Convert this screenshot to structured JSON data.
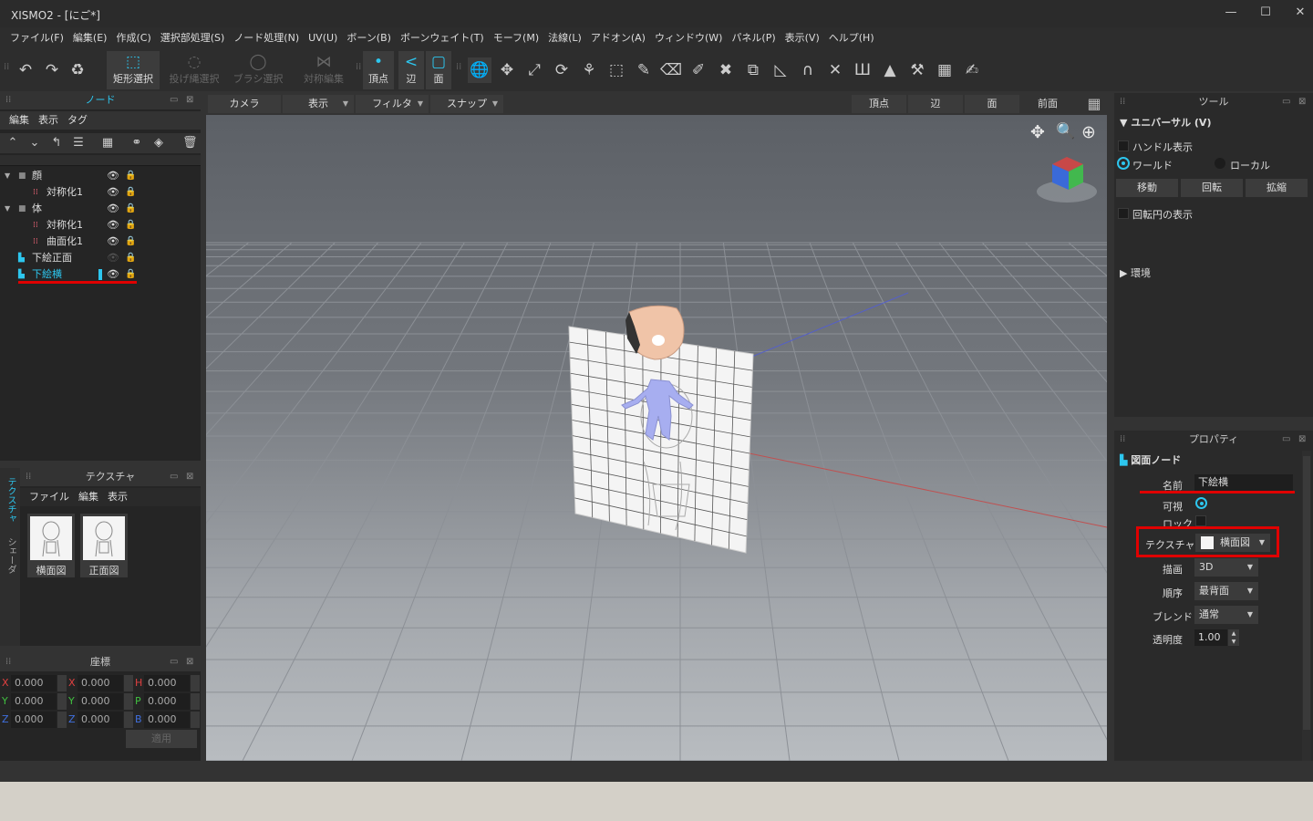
{
  "window": {
    "title": "XISMO2 - [にご*]",
    "min": "—",
    "max": "☐",
    "close": "✕"
  },
  "menubar": [
    "ファイル(F)",
    "編集(E)",
    "作成(C)",
    "選択部処理(S)",
    "ノード処理(N)",
    "UV(U)",
    "ボーン(B)",
    "ボーンウェイト(T)",
    "モーフ(M)",
    "法線(L)",
    "アドオン(A)",
    "ウィンドウ(W)",
    "パネル(P)",
    "表示(V)",
    "ヘルプ(H)"
  ],
  "toolbar": {
    "undo": "↶",
    "redo": "↷",
    "recycle": "♻",
    "rect_select": {
      "icon": "⬚",
      "label": "矩形選択"
    },
    "lasso_select": {
      "icon": "◌",
      "label": "投げ縄選択"
    },
    "brush_select": {
      "icon": "◯",
      "label": "ブラシ選択"
    },
    "symmetry_edit": {
      "icon": "⋈",
      "label": "対称編集"
    },
    "vertex": {
      "icon": "•",
      "label": "頂点"
    },
    "edge": {
      "icon": "<",
      "label": "辺"
    },
    "face": {
      "icon": "▢",
      "label": "面"
    },
    "tools": [
      "🌐",
      "✥",
      "⤢",
      "⟳",
      "⚘",
      "⬚",
      "✎",
      "⌫",
      "✐",
      "✖",
      "⧉",
      "◺",
      "∩",
      "✕",
      "Ш",
      "▲",
      "⚒",
      "▦",
      "✍"
    ]
  },
  "node_panel": {
    "title": "ノード",
    "menu": [
      "編集",
      "表示",
      "タグ"
    ],
    "icons": [
      "⌃",
      "⌄",
      "↰",
      "☰",
      "▦",
      "⚭",
      "◈",
      "🗑"
    ],
    "nodes": [
      {
        "label": "顔",
        "indent": 0,
        "expand": "▼",
        "icon": "■",
        "eye": "👁",
        "lock": "🔒",
        "selected": false
      },
      {
        "label": "対称化1",
        "indent": 1,
        "expand": "",
        "icon": "⁞⁞",
        "eye": "👁",
        "lock": "🔒",
        "selected": false
      },
      {
        "label": "体",
        "indent": 0,
        "expand": "▼",
        "icon": "■",
        "eye": "👁",
        "lock": "🔒",
        "selected": false
      },
      {
        "label": "対称化1",
        "indent": 1,
        "expand": "",
        "icon": "⁞⁞",
        "eye": "👁",
        "lock": "🔒",
        "selected": false
      },
      {
        "label": "曲面化1",
        "indent": 1,
        "expand": "",
        "icon": "⁞⁞",
        "eye": "👁",
        "lock": "🔒",
        "selected": false
      },
      {
        "label": "下絵正面",
        "indent": 0,
        "expand": "",
        "icon": "▙",
        "eye": "👁",
        "lock": "🔒",
        "selected": false
      },
      {
        "label": "下絵横",
        "indent": 0,
        "expand": "",
        "icon": "▙",
        "eye": "👁",
        "lock": "🔒",
        "selected": true
      }
    ]
  },
  "texture_panel": {
    "title": "テクスチャ",
    "menu": [
      "ファイル",
      "編集",
      "表示"
    ],
    "side_tabs": [
      "テクスチャ",
      "シェーダ"
    ],
    "items": [
      {
        "label": "横面図"
      },
      {
        "label": "正面図"
      }
    ]
  },
  "coords_panel": {
    "title": "座標",
    "rows": [
      [
        {
          "axis": "X",
          "value": "0.000",
          "color": "#e04040"
        },
        {
          "axis": "X",
          "value": "0.000",
          "color": "#e04040"
        },
        {
          "axis": "H",
          "value": "0.000",
          "color": "#e04040"
        }
      ],
      [
        {
          "axis": "Y",
          "value": "0.000",
          "color": "#40c040"
        },
        {
          "axis": "Y",
          "value": "0.000",
          "color": "#40c040"
        },
        {
          "axis": "P",
          "value": "0.000",
          "color": "#40c040"
        }
      ],
      [
        {
          "axis": "Z",
          "value": "0.000",
          "color": "#4070e0"
        },
        {
          "axis": "Z",
          "value": "0.000",
          "color": "#4070e0"
        },
        {
          "axis": "B",
          "value": "0.000",
          "color": "#4070e0"
        }
      ]
    ],
    "apply": "適用"
  },
  "viewport_bar": {
    "camera": "カメラ",
    "display": "表示",
    "filter": "フィルタ",
    "snap": "スナップ",
    "vertex": "頂点",
    "edge": "辺",
    "face": "面",
    "view": "前面",
    "view_icon": "▦"
  },
  "viewport_icons": {
    "move": "✥",
    "zoom": "🔍",
    "rotate": "⊕"
  },
  "tool_panel": {
    "title": "ツール",
    "section": "ユニバーサル (V)",
    "handle_display": "ハンドル表示",
    "world": "ワールド",
    "local": "ローカル",
    "move": "移動",
    "rotate": "回転",
    "scale": "拡縮",
    "rotation_circle": "回転円の表示",
    "environment": "環境"
  },
  "property_panel": {
    "title": "プロパティ",
    "node_type": "図面ノード",
    "name_label": "名前",
    "name_value": "下絵横",
    "visible_label": "可視",
    "lock_label": "ロック",
    "texture_label": "テクスチャ",
    "texture_value": "横面図",
    "draw_label": "描画",
    "draw_value": "3D",
    "order_label": "順序",
    "order_value": "最背面",
    "blend_label": "ブレンド",
    "blend_value": "通常",
    "opacity_label": "透明度",
    "opacity_value": "1.00"
  },
  "colors": {
    "accent": "#2dc6ee",
    "highlight": "#e00000"
  }
}
